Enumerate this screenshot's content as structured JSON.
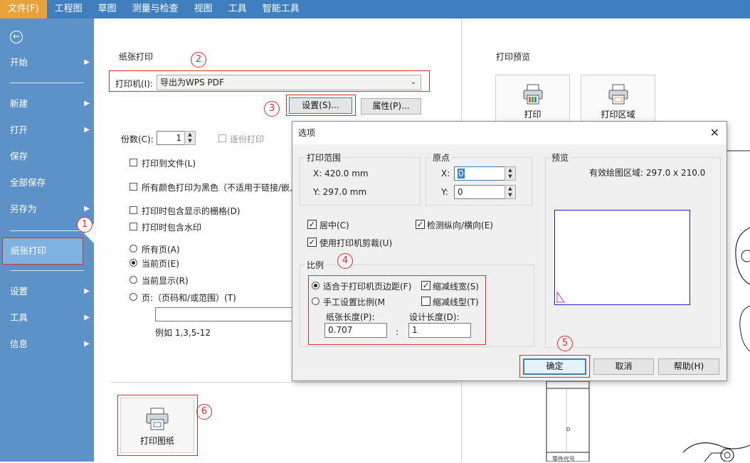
{
  "menubar": {
    "items": [
      "文件(F)",
      "工程图",
      "草图",
      "测量与检查",
      "视图",
      "工具",
      "智能工具"
    ]
  },
  "sidebar": {
    "items": [
      "开始",
      "新建",
      "打开",
      "保存",
      "全部保存",
      "另存为",
      "纸张打印",
      "设置",
      "工具",
      "信息"
    ]
  },
  "print_panel": {
    "title": "纸张打印",
    "printer_label": "打印机(I):",
    "printer_value": "导出为WPS PDF",
    "setup_button": "设置(S)...",
    "properties_button": "属性(P)...",
    "copies_label": "份数(C):",
    "copies_value": "1",
    "collate_label": "逐份打印",
    "print_to_file": "打印到文件(L)",
    "all_black": "所有颜色打印为黑色（不适用于链接/嵌入",
    "include_grid": "打印时包含显示的栅格(D)",
    "include_watermark": "打印时包含水印",
    "range_all": "所有页(A)",
    "range_current": "当前页(E)",
    "range_display": "当前显示(R)",
    "range_pages": "页:（页码和/或范围）(T)",
    "range_example": "例如 1,3,5-12",
    "print_drawing_button": "打印图纸"
  },
  "preview_panel": {
    "title": "打印预览",
    "print_button": "打印",
    "print_area_button": "打印区域",
    "drawing_text_d": "D",
    "drawing_text_part": "零件代号"
  },
  "dialog": {
    "title": "选项",
    "print_range_title": "打印范围",
    "x_value": "X: 420.0 mm",
    "y_value": "Y: 297.0 mm",
    "origin_title": "原点",
    "origin_x_label": "X:",
    "origin_x_value": "0",
    "origin_y_label": "Y:",
    "origin_y_value": "0",
    "center_label": "居中(C)",
    "detect_orientation_label": "检测纵向/横向(E)",
    "use_printer_clip_label": "使用打印机剪裁(U)",
    "scale_title": "比例",
    "fit_margins_label": "适合于打印机页边距(F)",
    "scale_line_width_label": "缩减线宽(S)",
    "manual_scale_label": "手工设置比例(M",
    "scale_line_type_label": "缩减线型(T)",
    "paper_length_label": "纸张长度(P):",
    "paper_length_value": "0.707",
    "design_length_label": "设计长度(D):",
    "design_length_value": "1",
    "colon": ":",
    "preview_title": "预览",
    "effective_area": "有效绘图区域:  297.0   x   210.0",
    "ok_button": "确定",
    "cancel_button": "取消",
    "help_button": "帮助(H)"
  },
  "annotations": [
    "1",
    "2",
    "3",
    "4",
    "5",
    "6"
  ],
  "colors": {
    "menubar": "#3f7fc0",
    "active_menu": "#e8a23a",
    "sidebar": "#5d92c9",
    "sidebar_selected": "#7fb3df",
    "annotation_red": "#d93030",
    "preview_rect": "#2020c0"
  }
}
